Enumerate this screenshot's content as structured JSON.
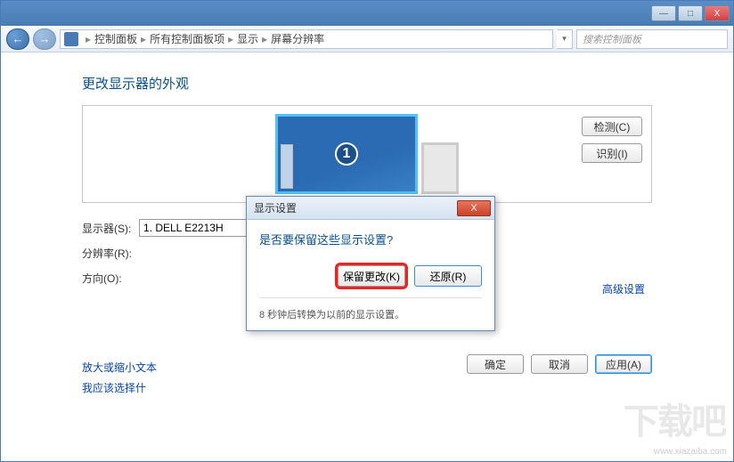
{
  "titlebar": {
    "min": "—",
    "max": "□",
    "close": "X"
  },
  "nav": {
    "back": "←",
    "fwd": "→"
  },
  "breadcrumb": {
    "sep1": "▸",
    "item1": "控制面板",
    "sep2": "▸",
    "item2": "所有控制面板项",
    "sep3": "▸",
    "item3": "显示",
    "sep4": "▸",
    "item4": "屏幕分辨率",
    "dropdown": "▾"
  },
  "search": {
    "placeholder": "搜索控制面板"
  },
  "heading": "更改显示器的外观",
  "monitor": {
    "number": "1"
  },
  "side_buttons": {
    "detect": "检测(C)",
    "identify": "识别(I)"
  },
  "form": {
    "display_label": "显示器(S):",
    "display_value": "1. DELL E2213H",
    "resolution_label": "分辨率(R):",
    "orientation_label": "方向(O):"
  },
  "links": {
    "text_size": "放大或缩小文本",
    "choose": "我应该选择什",
    "advanced": "高级设置"
  },
  "footer": {
    "ok": "确定",
    "cancel": "取消",
    "apply": "应用(A)"
  },
  "dialog": {
    "title": "显示设置",
    "close": "X",
    "question": "是否要保留这些显示设置?",
    "keep": "保留更改(K)",
    "revert": "还原(R)",
    "countdown": "8 秒钟后转换为以前的显示设置。"
  },
  "watermark": {
    "url": "www.xiazaiba.com",
    "logo": "下载吧"
  }
}
